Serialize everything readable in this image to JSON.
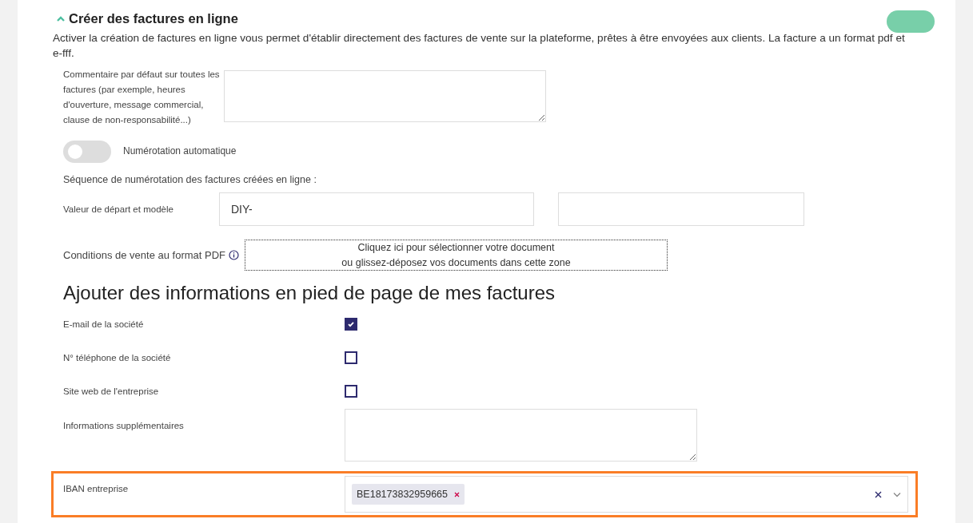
{
  "section": {
    "title": "Créer des factures en ligne",
    "expanded": true,
    "description": "Activer la création de factures en ligne vous permet d'établir directement des factures de vente sur la plateforme, prêtes à être envoyées aux clients. La facture a un format pdf et e-fff."
  },
  "comment": {
    "label": "Commentaire par défaut sur toutes les factures (par exemple, heures d'ouverture, message commercial, clause de non-responsabilité...)"
  },
  "auto_numbering": {
    "label": "Numérotation automatique",
    "on": false
  },
  "sequence": {
    "title": "Séquence de numérotation des factures créées en ligne :",
    "label": "Valeur de départ et modèle",
    "prefix": "DIY-"
  },
  "terms": {
    "label": "Conditions de vente au format PDF",
    "drop_lines": [
      "Cliquez ici pour sélectionner votre document",
      "ou glissez-déposez vos documents dans cette zone"
    ]
  },
  "footer": {
    "title": "Ajouter des informations en pied de page de mes factures",
    "options": [
      {
        "label": "E-mail de la société",
        "checked": true
      },
      {
        "label": "N° téléphone de la société",
        "checked": false
      },
      {
        "label": "Site web de l'entreprise",
        "checked": false
      }
    ],
    "extra_label": "Informations supplémentaires",
    "iban": {
      "label": "IBAN entreprise",
      "highlighted": true,
      "tags": [
        "BE18173832959665"
      ]
    }
  }
}
